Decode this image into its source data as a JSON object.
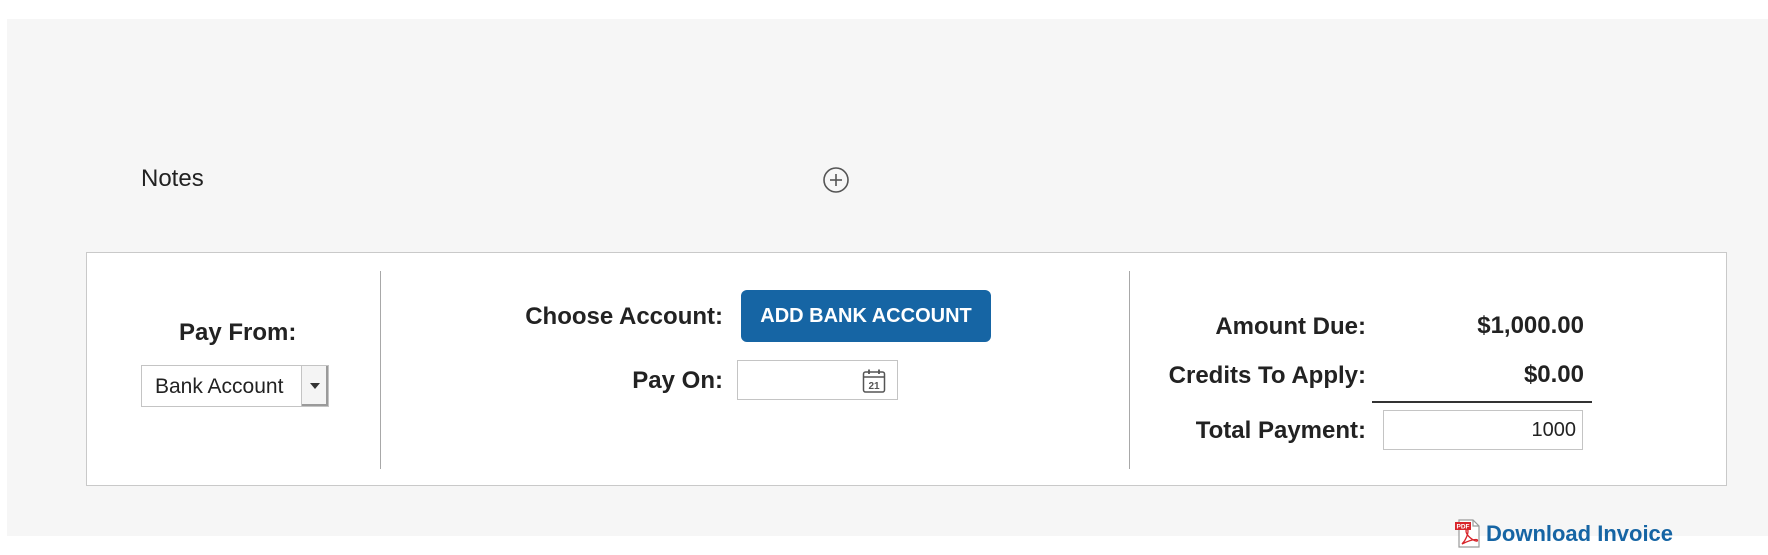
{
  "notes": {
    "label": "Notes",
    "add_icon": "plus-circle-icon"
  },
  "pay_from": {
    "label": "Pay From:",
    "selected": "Bank Account"
  },
  "account": {
    "choose_label": "Choose Account:",
    "add_button_label": "ADD BANK ACCOUNT",
    "pay_on_label": "Pay On:",
    "pay_on_value": "",
    "calendar_icon": "calendar-icon",
    "calendar_day": "21"
  },
  "summary": {
    "amount_due_label": "Amount Due:",
    "amount_due_value": "$1,000.00",
    "credits_label": "Credits To Apply:",
    "credits_value": "$0.00",
    "total_label": "Total Payment:",
    "total_value": "1000"
  },
  "download": {
    "label": "Download Invoice",
    "icon": "pdf-icon",
    "icon_text": "PDF"
  },
  "colors": {
    "accent": "#1665a4",
    "panel_background": "#f6f6f6",
    "pdf_red": "#d8242a"
  }
}
